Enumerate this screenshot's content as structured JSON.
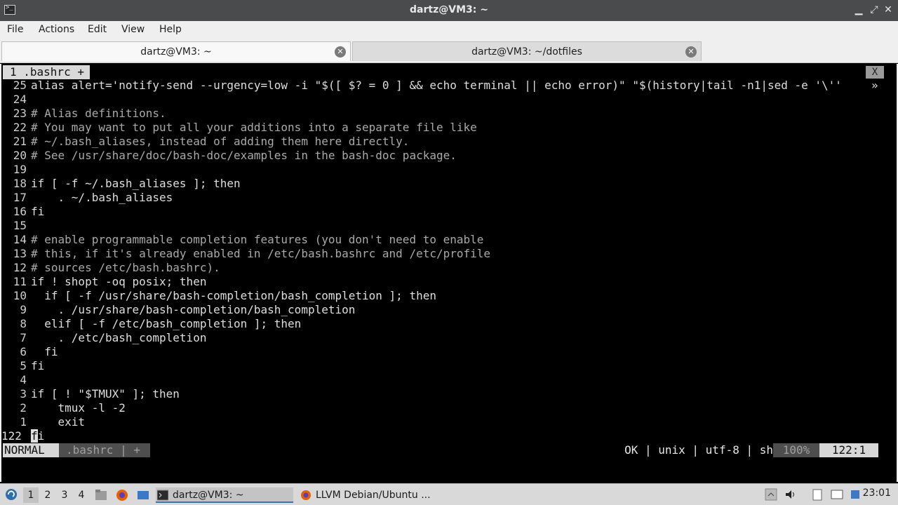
{
  "window": {
    "title": "dartz@VM3: ~",
    "minimize": "▁",
    "maximize": "⤢",
    "close": "✕"
  },
  "menu": [
    "File",
    "Actions",
    "Edit",
    "View",
    "Help"
  ],
  "tabs": [
    {
      "label": "dartz@VM3: ~",
      "active": true
    },
    {
      "label": "dartz@VM3: ~/dotfiles",
      "active": false
    }
  ],
  "vim": {
    "buffer_tab": "1 .bashrc +",
    "close_label": "X",
    "lines": [
      {
        "num": "25",
        "text": "alias alert='notify-send --urgency=low -i \"$([ $? = 0 ] && echo terminal || echo error)\" \"$(history|tail -n1|sed -e '\\''",
        "trail": "»"
      },
      {
        "num": "24",
        "text": ""
      },
      {
        "num": "23",
        "text": "# Alias definitions."
      },
      {
        "num": "22",
        "text": "# You may want to put all your additions into a separate file like"
      },
      {
        "num": "21",
        "text": "# ~/.bash_aliases, instead of adding them here directly."
      },
      {
        "num": "20",
        "text": "# See /usr/share/doc/bash-doc/examples in the bash-doc package."
      },
      {
        "num": "19",
        "text": ""
      },
      {
        "num": "18",
        "text": "if [ -f ~/.bash_aliases ]; then"
      },
      {
        "num": "17",
        "text": "    . ~/.bash_aliases"
      },
      {
        "num": "16",
        "text": "fi"
      },
      {
        "num": "15",
        "text": ""
      },
      {
        "num": "14",
        "text": "# enable programmable completion features (you don't need to enable"
      },
      {
        "num": "13",
        "text": "# this, if it's already enabled in /etc/bash.bashrc and /etc/profile"
      },
      {
        "num": "12",
        "text": "# sources /etc/bash.bashrc)."
      },
      {
        "num": "11",
        "text": "if ! shopt -oq posix; then"
      },
      {
        "num": "10",
        "text": "  if [ -f /usr/share/bash-completion/bash_completion ]; then"
      },
      {
        "num": "9",
        "text": "    . /usr/share/bash-completion/bash_completion"
      },
      {
        "num": "8",
        "text": "  elif [ -f /etc/bash_completion ]; then"
      },
      {
        "num": "7",
        "text": "    . /etc/bash_completion"
      },
      {
        "num": "6",
        "text": "  fi"
      },
      {
        "num": "5",
        "text": "fi"
      },
      {
        "num": "4",
        "text": ""
      },
      {
        "num": "3",
        "text": "if [ ! \"$TMUX\" ]; then"
      },
      {
        "num": "2",
        "text": "    tmux -l -2"
      },
      {
        "num": "1",
        "text": "    exit"
      },
      {
        "num": "122",
        "text": "fi",
        "current": true
      }
    ],
    "status": {
      "mode": "NORMAL",
      "file": ".bashrc | +",
      "info": "OK | unix | utf-8 | sh",
      "percent": "100%",
      "position": "122:1"
    }
  },
  "taskbar": {
    "workspaces": [
      "1",
      "2",
      "3",
      "4"
    ],
    "tasks": [
      {
        "label": "dartz@VM3: ~",
        "icon": "terminal-icon",
        "active": true
      },
      {
        "label": "LLVM Debian/Ubuntu ...",
        "icon": "firefox-icon",
        "active": false
      }
    ],
    "clock": "23:01"
  }
}
